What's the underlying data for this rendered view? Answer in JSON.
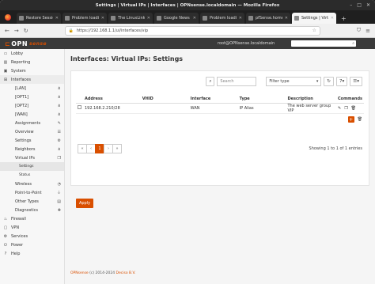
{
  "browser": {
    "window_title": "Settings | Virtual IPs | Interfaces | OPNsense.localdomain — Mozilla Firefox",
    "tabs": [
      {
        "label": "Restore Session",
        "active": false
      },
      {
        "label": "Problem loading",
        "active": false
      },
      {
        "label": "The LinuxLink Tec",
        "active": false
      },
      {
        "label": "Google News",
        "active": false
      },
      {
        "label": "Problem loading",
        "active": false
      },
      {
        "label": "pfSense.home.a",
        "active": false
      },
      {
        "label": "Settings | Virtual",
        "active": true
      }
    ],
    "url": "https://192.168.1.1/ui/interfaces/vip",
    "url_host": "192.168.1.1",
    "new_tab": "+"
  },
  "header": {
    "logo_opn": "OPN",
    "logo_sense": "sense",
    "user": "root@OPNsense.localdomain"
  },
  "sidebar": {
    "items": [
      {
        "label": "Lobby",
        "icon": "laptop-icon"
      },
      {
        "label": "Reporting",
        "icon": "chart-icon"
      },
      {
        "label": "System",
        "icon": "computer-icon"
      },
      {
        "label": "Interfaces",
        "icon": "network-icon"
      }
    ],
    "interfaces_sub": [
      {
        "label": "[LAN]"
      },
      {
        "label": "[OPT1]"
      },
      {
        "label": "[OPT2]"
      },
      {
        "label": "[WAN]"
      },
      {
        "label": "Assignments"
      },
      {
        "label": "Overview"
      },
      {
        "label": "Settings"
      },
      {
        "label": "Neighbors"
      },
      {
        "label": "Virtual IPs"
      }
    ],
    "vip_sub": [
      {
        "label": "Settings"
      },
      {
        "label": "Status"
      }
    ],
    "interfaces_sub2": [
      {
        "label": "Wireless"
      },
      {
        "label": "Point-to-Point"
      },
      {
        "label": "Other Types"
      },
      {
        "label": "Diagnostics"
      }
    ],
    "bottom_items": [
      {
        "label": "Firewall",
        "icon": "fire-icon"
      },
      {
        "label": "VPN",
        "icon": "lock-icon"
      },
      {
        "label": "Services",
        "icon": "cog-icon"
      },
      {
        "label": "Power",
        "icon": "power-icon"
      },
      {
        "label": "Help",
        "icon": "help-icon"
      }
    ]
  },
  "main": {
    "title": "Interfaces: Virtual IPs: Settings",
    "search_placeholder": "Search",
    "filter_placeholder": "Filter type",
    "page_size": "7",
    "columns": [
      "Address",
      "VHID",
      "Interface",
      "Type",
      "Description",
      "Commands"
    ],
    "rows": [
      {
        "address": "192.168.2.210/28",
        "vhid": "",
        "interface": "WAN",
        "type": "IP Alias",
        "description": "The web server group VIP"
      }
    ],
    "pager": {
      "prev_first": "«",
      "prev": "‹",
      "current": "1",
      "next": "›",
      "last": "»"
    },
    "pager_info": "Showing 1 to 1 of 1 entries",
    "apply_label": "Apply"
  },
  "footer": {
    "brand": "OPNsense",
    "text": " (c) 2014-2024 ",
    "company": "Deciso B.V."
  }
}
